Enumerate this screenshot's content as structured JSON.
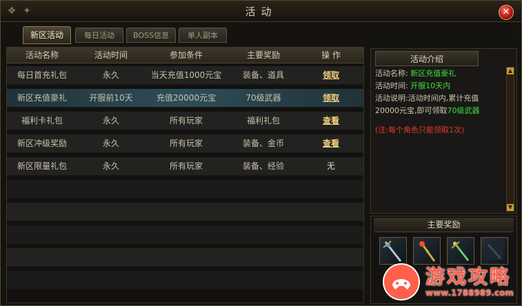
{
  "window": {
    "title": "活动",
    "close_label": "✕"
  },
  "tabs": [
    {
      "label": "新区活动",
      "active": true
    },
    {
      "label": "每日活动",
      "active": false
    },
    {
      "label": "BOSS信息",
      "active": false
    },
    {
      "label": "单人副本",
      "active": false
    }
  ],
  "table": {
    "headers": [
      "活动名称",
      "活动时间",
      "参加条件",
      "主要奖励",
      "操 作"
    ],
    "rows": [
      {
        "name": "每日首充礼包",
        "time": "永久",
        "cond": "当天充值1000元宝",
        "reward": "装备、道具",
        "action": "领取",
        "action_type": "link"
      },
      {
        "name": "新区充值豪礼",
        "time": "开服前10天",
        "cond": "充值20000元宝",
        "reward": "70级武器",
        "action": "领取",
        "action_type": "link",
        "selected": true
      },
      {
        "name": "福利卡礼包",
        "time": "永久",
        "cond": "所有玩家",
        "reward": "福利礼包",
        "action": "查看",
        "action_type": "link"
      },
      {
        "name": "新区冲级奖励",
        "time": "永久",
        "cond": "所有玩家",
        "reward": "装备、金币",
        "action": "查看",
        "action_type": "link"
      },
      {
        "name": "新区限量礼包",
        "time": "永久",
        "cond": "所有玩家",
        "reward": "装备、经验",
        "action": "无",
        "action_type": "text"
      }
    ]
  },
  "intro": {
    "header": "活动介绍",
    "name_label": "活动名称:",
    "name_value": "新区充值豪礼",
    "time_label": "活动时间:",
    "time_value": "开服10天内",
    "desc_label": "活动说明:",
    "desc_text1": "活动时间内,累计充值",
    "desc_text2": "20000元宝,即可领取",
    "desc_value": "70级武器",
    "note": "(注:每个角色只能领取1次)"
  },
  "rewards": {
    "header": "主要奖励",
    "items": [
      {
        "icon": "jeweled-sword-icon"
      },
      {
        "icon": "golden-staff-icon"
      },
      {
        "icon": "green-blade-icon"
      },
      {
        "icon": "dark-weapon-icon"
      }
    ]
  },
  "watermark": {
    "text": "游戏攻略",
    "url": "www.1788989.com"
  },
  "colors": {
    "highlight": "#3fdc3f",
    "note": "#e23a2a",
    "link": "#f2d27a",
    "selected_row": "#2e4d58"
  }
}
